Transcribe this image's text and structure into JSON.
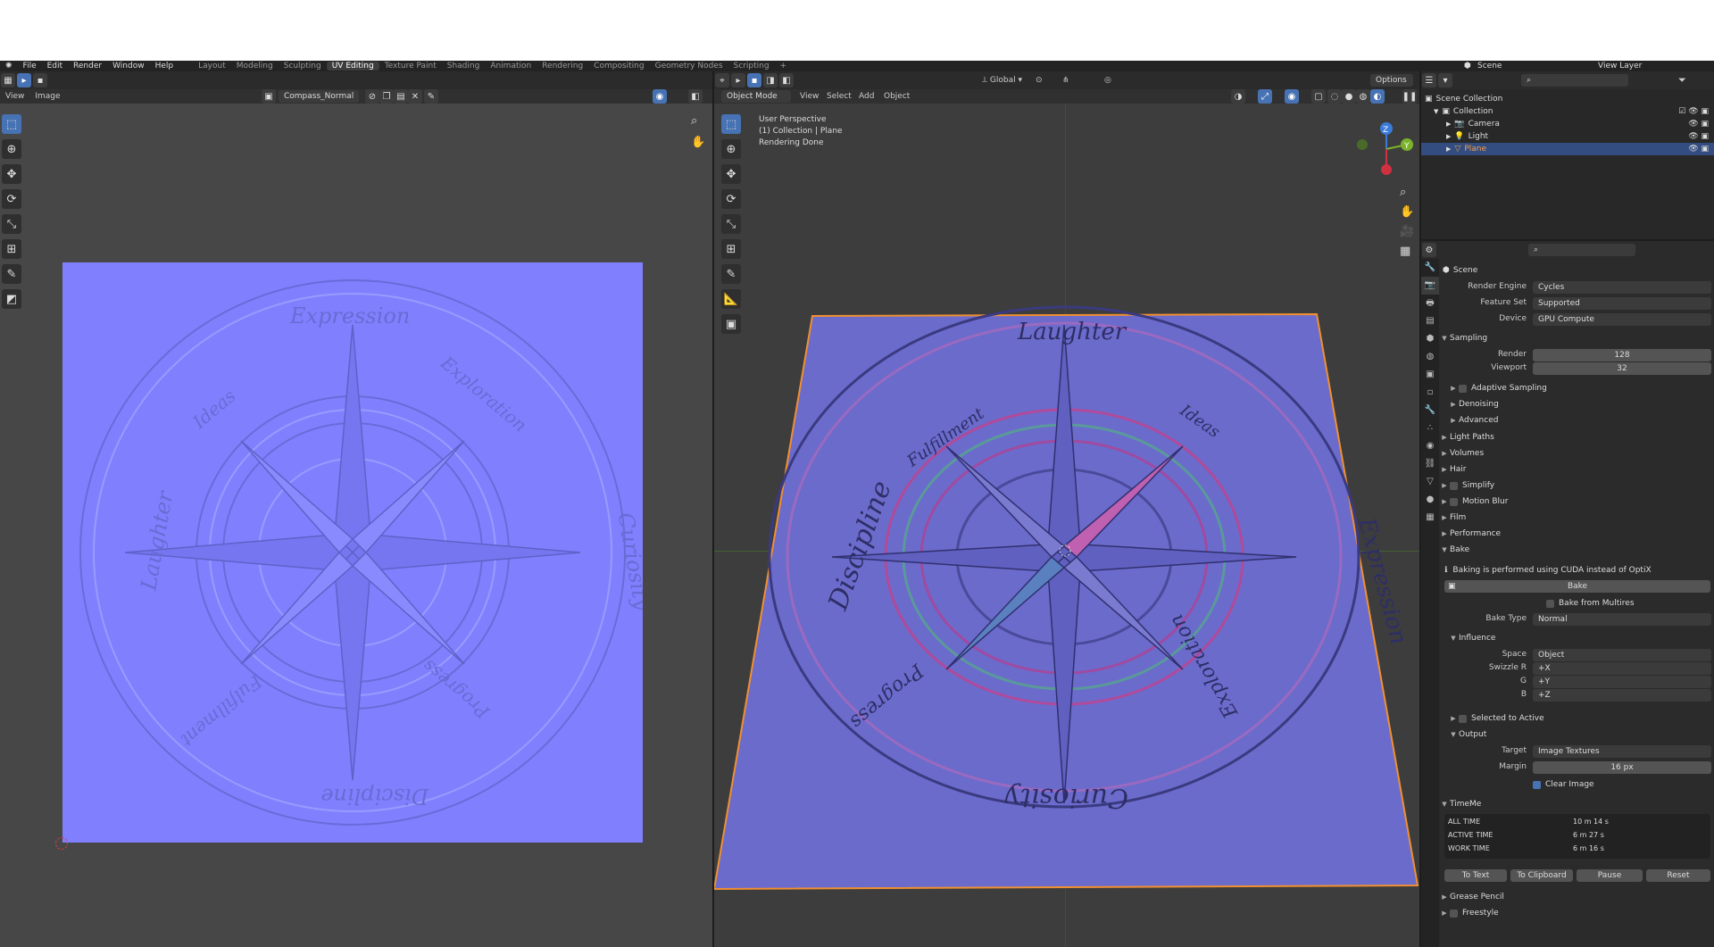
{
  "topbar": {
    "menus": [
      "File",
      "Edit",
      "Render",
      "Window",
      "Help"
    ],
    "workspaces": [
      "Layout",
      "Modeling",
      "Sculpting",
      "UV Editing",
      "Texture Paint",
      "Shading",
      "Animation",
      "Rendering",
      "Compositing",
      "Geometry Nodes",
      "Scripting"
    ],
    "active_workspace": "UV Editing",
    "add_tab": "+",
    "scene_label": "Scene",
    "view_layer_label": "View Layer"
  },
  "uv_editor": {
    "menu_view": "View",
    "menu_image": "Image",
    "image_name": "Compass_Normal",
    "texture_color": "#8080ff",
    "labels": [
      "Expression",
      "Exploration",
      "Curiosity",
      "Progress",
      "Discipline",
      "Fulfillment",
      "Laughter",
      "Ideas"
    ]
  },
  "viewport": {
    "mode": "Object Mode",
    "menus": [
      "View",
      "Select",
      "Add",
      "Object"
    ],
    "transform": "Global",
    "options": "Options",
    "overlay_line1": "User Perspective",
    "overlay_line2": "(1) Collection | Plane",
    "overlay_line3": "Rendering Done",
    "gizmo_z": "Z",
    "gizmo_y": "Y",
    "labels": [
      "Laughter",
      "Expression",
      "Exploration",
      "Curiosity",
      "Progress",
      "Discipline",
      "Fulfillment",
      "Ideas"
    ]
  },
  "outliner": {
    "root": "Scene Collection",
    "collection": "Collection",
    "items": [
      {
        "name": "Camera",
        "selected": false
      },
      {
        "name": "Light",
        "selected": false
      },
      {
        "name": "Plane",
        "selected": true
      }
    ]
  },
  "properties": {
    "context": "Scene",
    "render_engine_label": "Render Engine",
    "render_engine": "Cycles",
    "feature_set_label": "Feature Set",
    "feature_set": "Supported",
    "device_label": "Device",
    "device": "GPU Compute",
    "sampling": "Sampling",
    "render_label": "Render",
    "render_samples": "128",
    "viewport_label": "Viewport",
    "viewport_samples": "32",
    "adaptive_sampling": "Adaptive Sampling",
    "denoising": "Denoising",
    "advanced": "Advanced",
    "light_paths": "Light Paths",
    "volumes": "Volumes",
    "hair": "Hair",
    "simplify": "Simplify",
    "motion_blur": "Motion Blur",
    "film": "Film",
    "performance": "Performance",
    "bake": "Bake",
    "bake_info": "Baking is performed using CUDA instead of OptiX",
    "bake_button": "Bake",
    "bake_from_multires": "Bake from Multires",
    "bake_type_label": "Bake Type",
    "bake_type": "Normal",
    "influence": "Influence",
    "space_label": "Space",
    "space": "Object",
    "swizzle_r_label": "Swizzle R",
    "swizzle_r": "+X",
    "g_label": "G",
    "swizzle_g": "+Y",
    "b_label": "B",
    "swizzle_b": "+Z",
    "selected_to_active": "Selected to Active",
    "output": "Output",
    "target_label": "Target",
    "target": "Image Textures",
    "margin_label": "Margin",
    "margin": "16 px",
    "clear_image": "Clear Image",
    "timeme": "TimeMe",
    "all_time_label": "ALL TIME",
    "all_time": "10 m 14 s",
    "active_time_label": "ACTIVE TIME",
    "active_time": "6 m 27 s",
    "work_time_label": "WORK TIME",
    "work_time": "6 m 16 s",
    "to_text": "To Text",
    "to_clipboard": "To Clipboard",
    "pause": "Pause",
    "reset": "Reset",
    "grease_pencil": "Grease Pencil",
    "freestyle": "Freestyle"
  }
}
